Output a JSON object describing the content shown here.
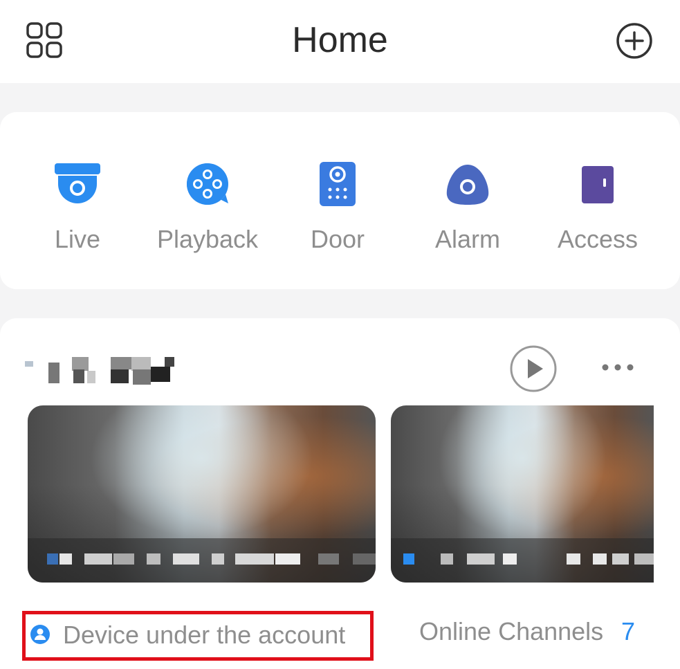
{
  "header": {
    "title": "Home",
    "menu_icon": "grid-menu-icon",
    "add_icon": "plus-circle-icon"
  },
  "quick_entries": [
    {
      "label": "Live",
      "icon": "dome-camera-icon",
      "color": "#2a8cf0"
    },
    {
      "label": "Playback",
      "icon": "film-reel-icon",
      "color": "#2a8cf0"
    },
    {
      "label": "Door",
      "icon": "door-station-icon",
      "color": "#3a7be0"
    },
    {
      "label": "Alarm",
      "icon": "alarm-sensor-icon",
      "color": "#4a68c0"
    },
    {
      "label": "Access",
      "icon": "access-control-icon",
      "color": "#5b4a9e"
    }
  ],
  "device": {
    "name": "",
    "play_icon": "play-circle-icon",
    "more_icon": "more-dots-icon",
    "channels": [
      {
        "caption": ""
      },
      {
        "caption": ""
      }
    ]
  },
  "footer": {
    "account_label": "Device under the account",
    "account_icon": "user-badge-icon",
    "online_label": "Online Channels",
    "online_count": "7"
  },
  "colors": {
    "accent": "#2a8cf0",
    "highlight_border": "#e0101a",
    "text_muted": "#8e8e8e",
    "title": "#2b2b2b"
  }
}
